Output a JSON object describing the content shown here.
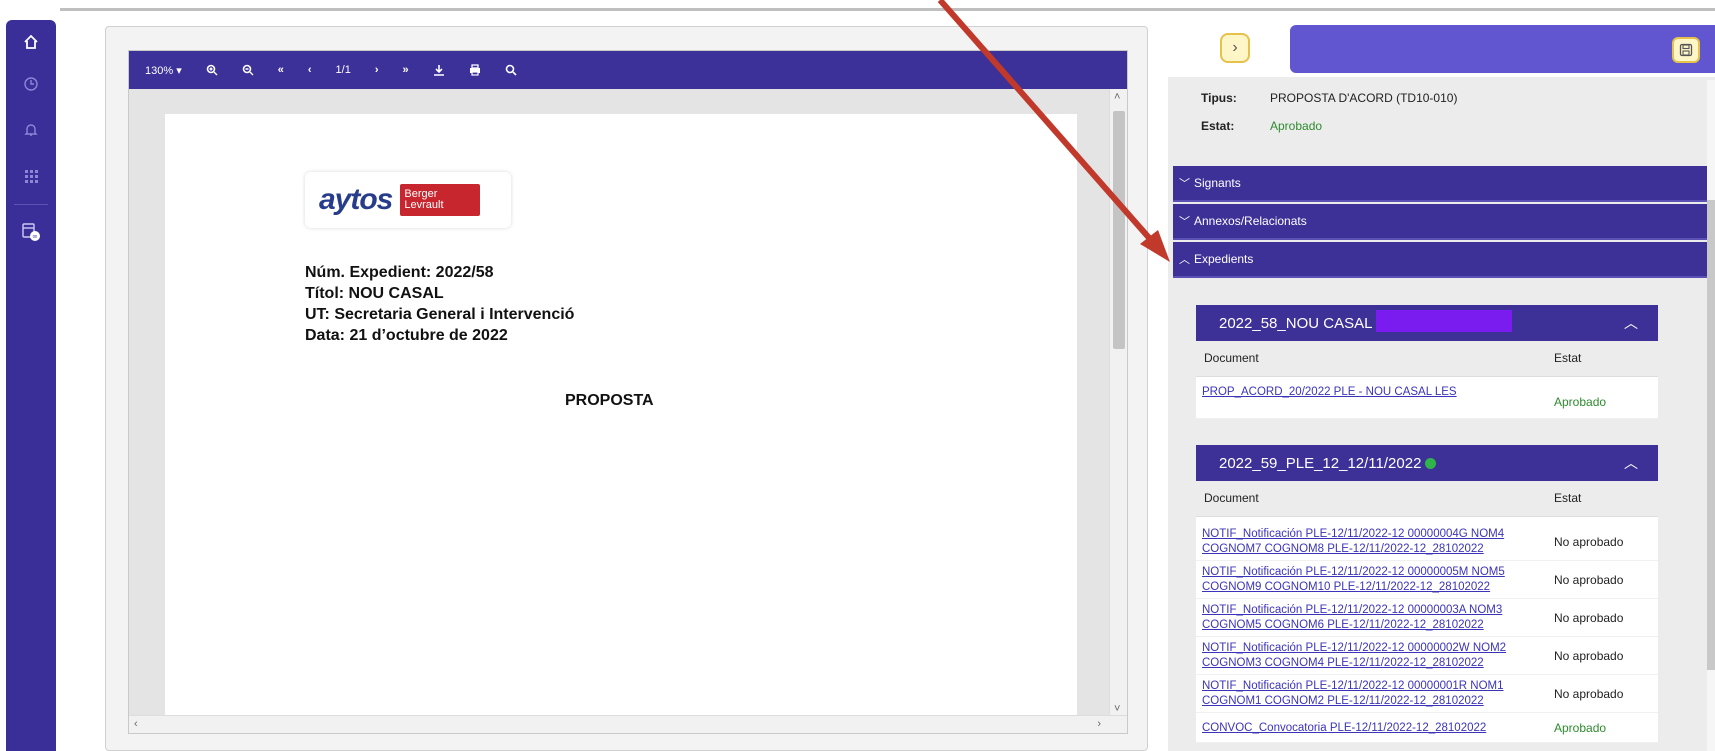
{
  "toolbar": {
    "zoom": "130% ▾",
    "page_indicator": "1/1"
  },
  "document": {
    "logo_text": "aytos",
    "logo_badge": "Berger Levrault",
    "lines": [
      "Núm. Expedient: 2022/58",
      "Títol: NOU CASAL",
      "UT: Secretaria General i Intervenció",
      "Data: 21 d’octubre de 2022"
    ],
    "heading": "PROPOSTA"
  },
  "meta": {
    "tipus_label": "Tipus:",
    "tipus_value": "PROPOSTA D'ACORD (TD10-010)",
    "estat_label": "Estat:",
    "estat_value": "Aprobado"
  },
  "accordions": {
    "signants": "Signants",
    "annexos": "Annexos/Relacionats",
    "expedients": "Expedients"
  },
  "expedients": [
    {
      "title": "2022_58_NOU CASAL L",
      "col_document": "Document",
      "col_estat": "Estat",
      "rows": [
        {
          "doc": "PROP_ACORD_20/2022 PLE - NOU CASAL LES",
          "estat": "Aprobado"
        }
      ]
    },
    {
      "title": "2022_59_PLE_12_12/11/2022",
      "col_document": "Document",
      "col_estat": "Estat",
      "rows": [
        {
          "doc": "NOTIF_Notificación PLE-12/11/2022-12 00000004G NOM4 COGNOM7 COGNOM8 PLE-12/11/2022-12_28102022",
          "estat": "No aprobado"
        },
        {
          "doc": "NOTIF_Notificación PLE-12/11/2022-12 00000005M NOM5 COGNOM9 COGNOM10 PLE-12/11/2022-12_28102022",
          "estat": "No aprobado"
        },
        {
          "doc": "NOTIF_Notificación PLE-12/11/2022-12 00000003A NOM3 COGNOM5 COGNOM6 PLE-12/11/2022-12_28102022",
          "estat": "No aprobado"
        },
        {
          "doc": "NOTIF_Notificación PLE-12/11/2022-12 00000002W NOM2 COGNOM3 COGNOM4 PLE-12/11/2022-12_28102022",
          "estat": "No aprobado"
        },
        {
          "doc": "NOTIF_Notificación PLE-12/11/2022-12 00000001R NOM1 COGNOM1 COGNOM2 PLE-12/11/2022-12_28102022",
          "estat": "No aprobado"
        },
        {
          "doc": "CONVOC_Convocatoria PLE-12/11/2022-12_28102022",
          "estat": "Aprobado"
        }
      ]
    }
  ],
  "colors": {
    "nav": "#3a2f98",
    "toolbar": "#3c3099",
    "accent_bar": "#6256d0",
    "approved": "#2e8b2e",
    "annotation_arrow": "#c0392b"
  }
}
